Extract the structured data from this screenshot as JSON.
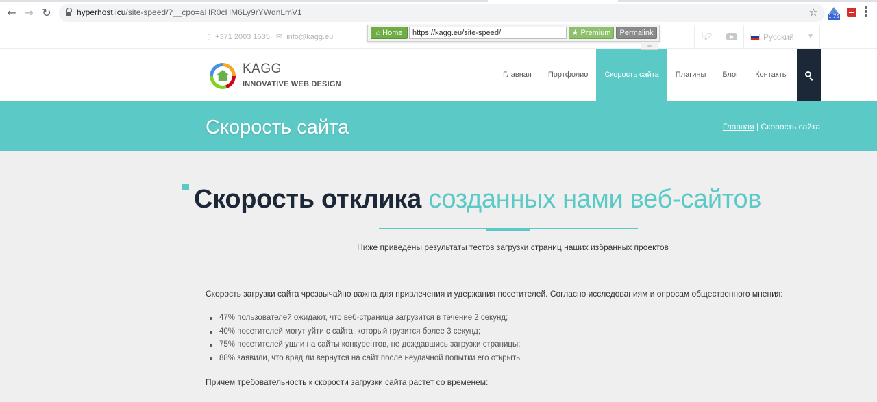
{
  "browser": {
    "url_host": "hyperhost.icu",
    "url_path": "/site-speed/?__cpo=aHR0cHM6Ly9rYWdnLmV1",
    "extension_badge": "1.75"
  },
  "topbar": {
    "phone": "+371 2003 1535",
    "email": "info@kagg.eu",
    "language": "Русский"
  },
  "bookmarklet": {
    "home_label": "Home",
    "url_value": "https://kagg.eu/site-speed/",
    "premium_label": "Premium",
    "permalink_label": "Permalink"
  },
  "header": {
    "logo_title": "KAGG",
    "logo_subtitle": "INNOVATIVE WEB DESIGN",
    "nav": [
      {
        "label": "Главная"
      },
      {
        "label": "Портфолио"
      },
      {
        "label": "Скорость сайта",
        "active": true
      },
      {
        "label": "Плагины"
      },
      {
        "label": "Блог"
      },
      {
        "label": "Контакты"
      }
    ]
  },
  "band": {
    "title": "Скорость сайта",
    "breadcrumb_home": "Главная",
    "breadcrumb_sep": "|",
    "breadcrumb_current": "Скорость сайта"
  },
  "content": {
    "heading_dark": "Скорость отклика",
    "heading_accent": "созданных нами веб-сайтов",
    "subtitle": "Ниже приведены результаты тестов загрузки страниц наших избранных проектов",
    "paragraph": "Скорость загрузки сайта чрезвычайно важна для привлечения и удержания посетителей. Согласно исследованиям и опросам общественного мнения:",
    "bullets": [
      "47% пользователей ожидают, что веб-страница загрузится в течение 2 секунд;",
      "40% посетителей могут уйти с сайта, который грузится более 3 секунд;",
      "75% посетителей ушли на сайты конкурентов, не дождавшись загрузки страницы;",
      "88% заявили, что вряд ли вернутся на сайт после неудачной попытки его открыть."
    ],
    "paragraph2": "Причем требовательность к скорости загрузки сайта растет со временем:"
  },
  "colors": {
    "accent": "#5bcac7",
    "dark": "#1c2738"
  }
}
